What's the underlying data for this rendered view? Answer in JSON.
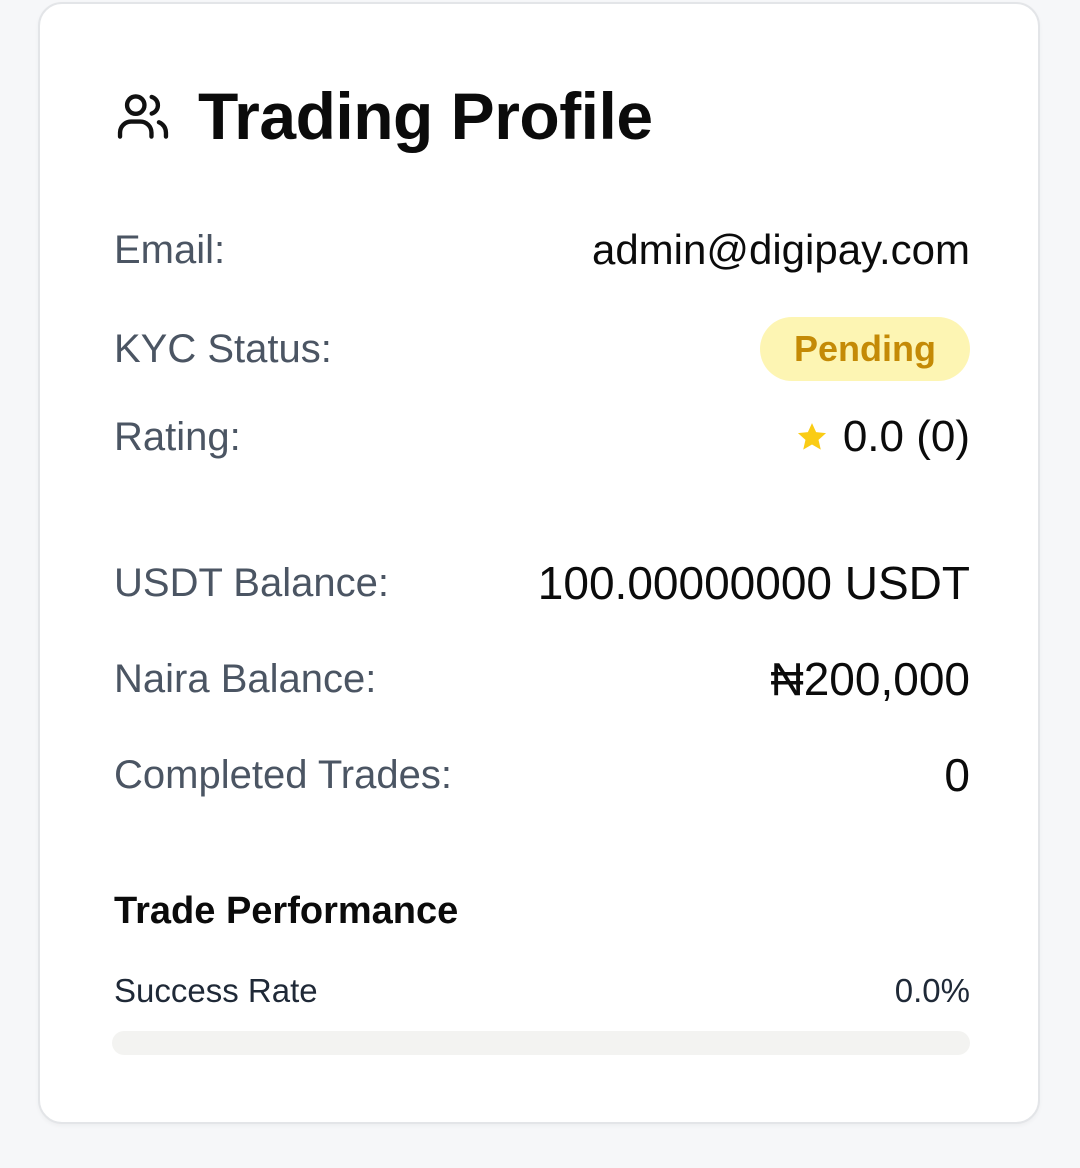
{
  "card": {
    "title": "Trading Profile",
    "icon": "users-icon"
  },
  "fields": {
    "email": {
      "label": "Email:",
      "value": "admin@digipay.com"
    },
    "kyc": {
      "label": "KYC Status:",
      "value": "Pending",
      "badge_bg": "#fdf5b3",
      "badge_text": "#c48a06"
    },
    "rating": {
      "label": "Rating:",
      "value": "0.0 (0)",
      "icon": "star-icon",
      "star_color": "#facc15"
    },
    "usdt": {
      "label": "USDT Balance:",
      "value": "100.00000000 USDT"
    },
    "naira": {
      "label": "Naira Balance:",
      "value": "₦200,000"
    },
    "trades": {
      "label": "Completed Trades:",
      "value": "0"
    }
  },
  "performance": {
    "title": "Trade Performance",
    "success_label": "Success Rate",
    "success_value": "0.0%",
    "success_fraction": 0.0
  }
}
